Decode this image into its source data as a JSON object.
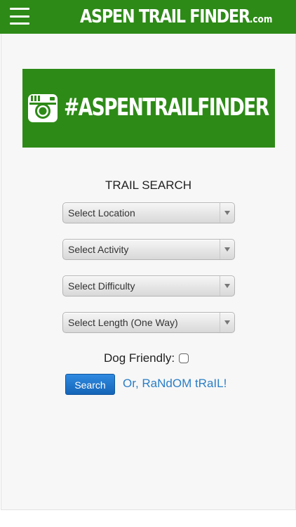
{
  "header": {
    "brand_main": "ASPEN TRAIL FINDER",
    "brand_tld": ".com",
    "menu_icon": "hamburger-menu-icon"
  },
  "banner": {
    "text": "#ASPENTRAILFINDER",
    "icon": "camera-icon"
  },
  "search": {
    "title": "TRAIL SEARCH",
    "location": "Select Location",
    "activity": "Select Activity",
    "difficulty": "Select Difficulty",
    "length": "Select Length (One Way)",
    "dog_label": "Dog Friendly:",
    "search_button": "Search",
    "random_link": "Or, RaNdOM tRaIL!"
  },
  "colors": {
    "brand_green": "#2d8a17",
    "button_blue": "#1f73c8",
    "link_blue": "#2a7ec6"
  }
}
